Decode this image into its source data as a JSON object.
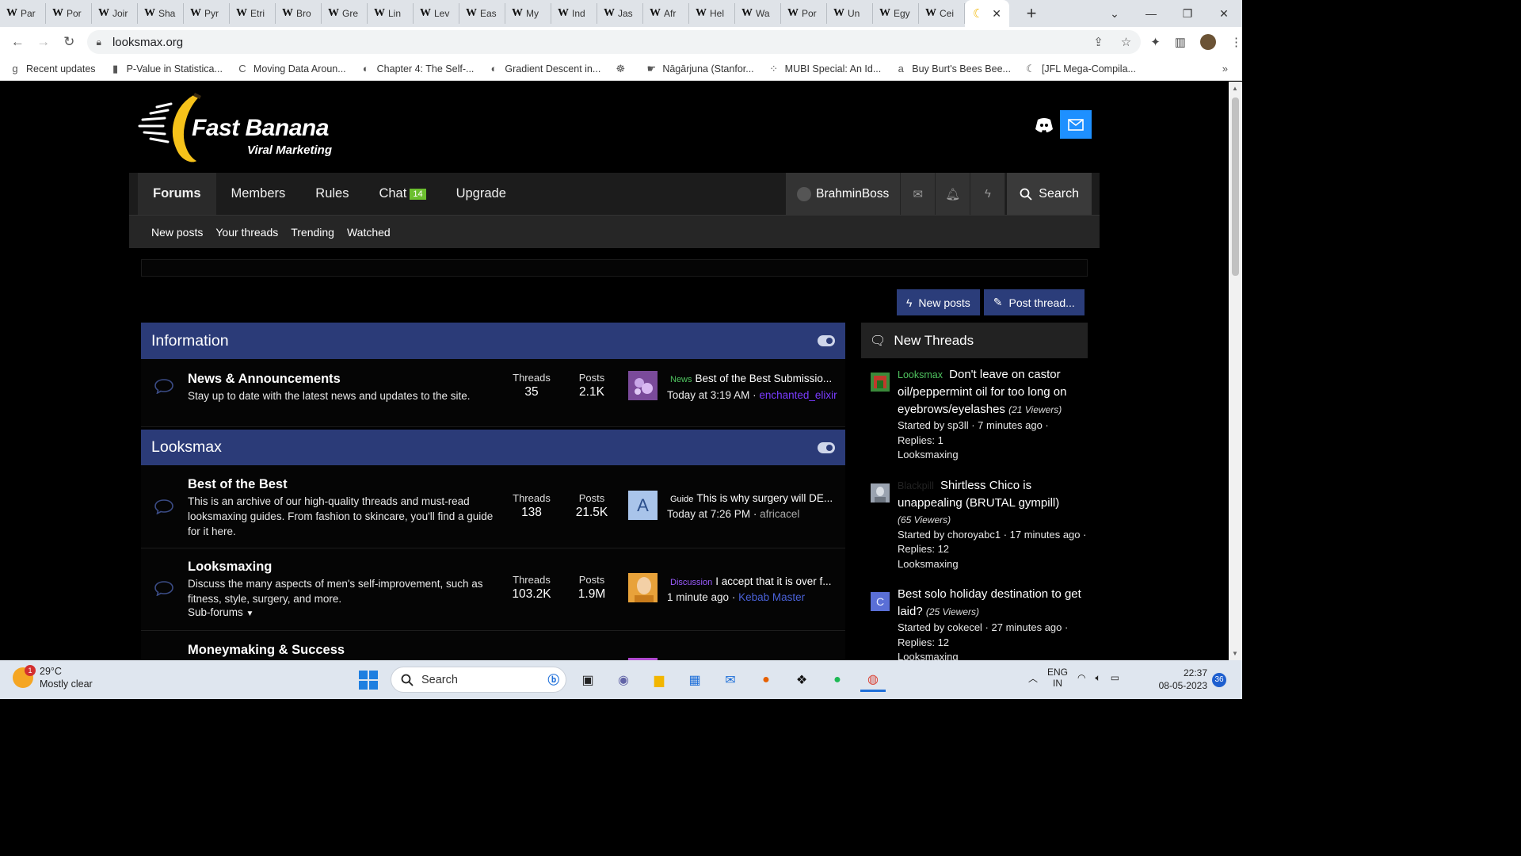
{
  "browser": {
    "tabs": [
      {
        "icon": "W",
        "label": "Par"
      },
      {
        "icon": "W",
        "label": "Por"
      },
      {
        "icon": "W",
        "label": "Joir"
      },
      {
        "icon": "W",
        "label": "Sha"
      },
      {
        "icon": "W",
        "label": "Pyr"
      },
      {
        "icon": "W",
        "label": "Etri"
      },
      {
        "icon": "W",
        "label": "Bro"
      },
      {
        "icon": "W",
        "label": "Gre"
      },
      {
        "icon": "W",
        "label": "Lin"
      },
      {
        "icon": "W",
        "label": "Lev"
      },
      {
        "icon": "W",
        "label": "Eas"
      },
      {
        "icon": "W",
        "label": "My"
      },
      {
        "icon": "W",
        "label": "Ind"
      },
      {
        "icon": "W",
        "label": "Jas"
      },
      {
        "icon": "W",
        "label": "Afr"
      },
      {
        "icon": "W",
        "label": "Hel"
      },
      {
        "icon": "W",
        "label": "Wa"
      },
      {
        "icon": "W",
        "label": "Por"
      },
      {
        "icon": "W",
        "label": "Un"
      },
      {
        "icon": "W",
        "label": "Egy"
      },
      {
        "icon": "W",
        "label": "Cei"
      }
    ],
    "url": "looksmax.org",
    "bookmarks": [
      {
        "icon": "g",
        "label": "Recent updates"
      },
      {
        "icon": "▮",
        "label": "P-Value in Statistica..."
      },
      {
        "icon": "C",
        "label": "Moving Data Aroun..."
      },
      {
        "icon": "◐",
        "label": "Chapter 4: The Self-..."
      },
      {
        "icon": "◐",
        "label": "Gradient Descent in..."
      },
      {
        "icon": "☸",
        "label": ""
      },
      {
        "icon": "☛",
        "label": "Nāgārjuna (Stanfor..."
      },
      {
        "icon": "⁘",
        "label": "MUBI Special: An Id..."
      },
      {
        "icon": "a",
        "label": "Buy Burt's Bees Bee..."
      },
      {
        "icon": "☾",
        "label": "[JFL Mega-Compila..."
      }
    ]
  },
  "site": {
    "logo_title": "Fast Banana",
    "logo_subtitle": "Viral Marketing",
    "nav": {
      "forums": "Forums",
      "members": "Members",
      "rules": "Rules",
      "chat": "Chat",
      "chat_count": "14",
      "upgrade": "Upgrade",
      "username": "BrahminBoss",
      "search": "Search"
    },
    "subnav": [
      "New posts",
      "Your threads",
      "Trending",
      "Watched"
    ],
    "actions": {
      "new_posts": "New posts",
      "post_thread": "Post thread..."
    },
    "colors": {
      "accent": "#2b3b78",
      "button": "#2b3d7a",
      "green": "#6cbf2f",
      "link_purple": "#7a3cff"
    }
  },
  "sections": [
    {
      "title": "Information",
      "forums": [
        {
          "name": "News & Announcements",
          "description": "Stay up to date with the latest news and updates to the site.",
          "threads_label": "Threads",
          "threads": "35",
          "posts_label": "Posts",
          "posts": "2.1K",
          "last_prefix": "News",
          "last_title": "Best of the Best Submissio...",
          "last_time": "Today at 3:19 AM",
          "last_user": "enchanted_elixir"
        }
      ]
    },
    {
      "title": "Looksmax",
      "forums": [
        {
          "name": "Best of the Best",
          "description": "This is an archive of our high-quality threads and must-read looksmaxing guides. From fashion to skincare, you'll find a guide for it here.",
          "threads_label": "Threads",
          "threads": "138",
          "posts_label": "Posts",
          "posts": "21.5K",
          "last_prefix": "Guide",
          "last_title": "This is why surgery will DE...",
          "last_time": "Today at 7:26 PM",
          "last_user": "africacel",
          "avatar_letter": "A"
        },
        {
          "name": "Looksmaxing",
          "description": "Discuss the many aspects of men's self-improvement, such as fitness, style, surgery, and more.",
          "subforums": "Sub-forums",
          "threads_label": "Threads",
          "threads": "103.2K",
          "posts_label": "Posts",
          "posts": "1.9M",
          "last_prefix": "Discussion",
          "last_title": "I accept that it is over f...",
          "last_time": "1 minute ago",
          "last_user": "Kebab Master"
        },
        {
          "name": "Moneymaking & Success"
        }
      ]
    }
  ],
  "sidebar": {
    "title": "New Threads",
    "threads": [
      {
        "prefix": "Looksmax",
        "title": "Don't leave on castor oil/peppermint oil for too long on eyebrows/eyelashes",
        "viewers": "(21 Viewers)",
        "started": "Started by sp3ll · 7 minutes ago ·",
        "replies": "Replies: 1",
        "forum": "Looksmaxing"
      },
      {
        "prefix": "Blackpill",
        "title": "Shirtless Chico is unappealing (BRUTAL gympill)",
        "viewers": "(65 Viewers)",
        "started": "Started by choroyabc1 · 17 minutes ago · Replies: 12",
        "forum": "Looksmaxing"
      },
      {
        "title": "Best solo holiday destination to get laid?",
        "viewers": "(25 Viewers)",
        "started": "Started by cokecel · 27 minutes ago ·",
        "replies": "Replies: 12",
        "forum": "Looksmaxing",
        "avatar_letter": "C"
      }
    ]
  },
  "taskbar": {
    "weather_badge": "1",
    "temperature": "29°C",
    "weather": "Mostly clear",
    "search": "Search",
    "lang_top": "ENG",
    "lang_bottom": "IN",
    "time": "22:37",
    "date": "08-05-2023",
    "notifications": "36"
  }
}
